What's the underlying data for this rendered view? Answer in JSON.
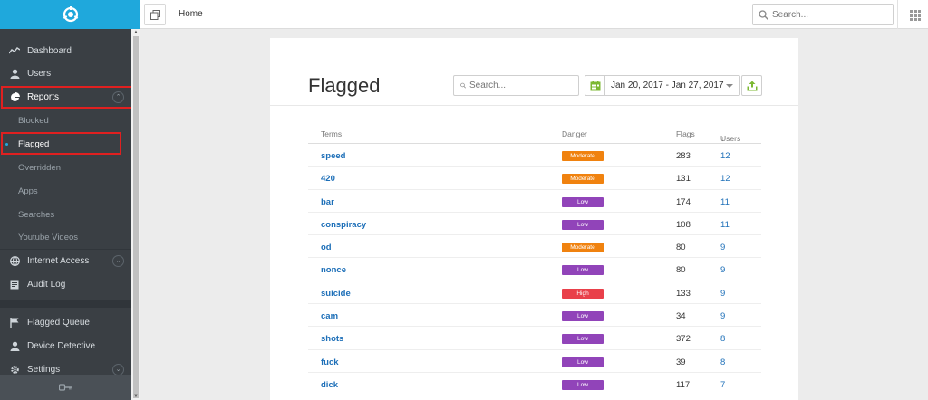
{
  "colors": {
    "brand": "#1fa8dc",
    "sidebar_bg": "#3a3f44",
    "link": "#1d6fb8",
    "highlight": "#e02020",
    "danger_moderate": "#f0820f",
    "danger_low": "#9144b9",
    "danger_high": "#e9404a",
    "calendar_green": "#7cb833"
  },
  "sidebar": {
    "logo_icon": "compass-logo-icon",
    "items": [
      {
        "label": "Dashboard",
        "icon": "chart-line-icon"
      },
      {
        "label": "Users",
        "icon": "user-icon"
      },
      {
        "label": "Reports",
        "icon": "pie-chart-icon"
      },
      {
        "label": "Blocked"
      },
      {
        "label": "Flagged"
      },
      {
        "label": "Overridden"
      },
      {
        "label": "Apps"
      },
      {
        "label": "Searches"
      },
      {
        "label": "Youtube Videos"
      },
      {
        "label": "Internet Access",
        "icon": "globe-icon"
      },
      {
        "label": "Audit Log",
        "icon": "document-icon"
      },
      {
        "label": "Flagged Queue",
        "icon": "flag-icon"
      },
      {
        "label": "Device Detective",
        "icon": "user-icon"
      },
      {
        "label": "Settings",
        "icon": "gear-icon"
      }
    ],
    "footer_icon": "key-icon"
  },
  "topbar": {
    "breadcrumb": "Home",
    "search_placeholder": "Search..."
  },
  "page": {
    "title": "Flagged",
    "search_placeholder": "Search...",
    "date_range": "Jan 20, 2017 - Jan 27, 2017"
  },
  "table": {
    "headers": {
      "terms": "Terms",
      "danger": "Danger",
      "flags": "Flags",
      "users": "Users"
    },
    "rows": [
      {
        "term": "speed",
        "danger": "Moderate",
        "flags": "283",
        "users": "12"
      },
      {
        "term": "420",
        "danger": "Moderate",
        "flags": "131",
        "users": "12"
      },
      {
        "term": "bar",
        "danger": "Low",
        "flags": "174",
        "users": "11"
      },
      {
        "term": "conspiracy",
        "danger": "Low",
        "flags": "108",
        "users": "11"
      },
      {
        "term": "od",
        "danger": "Moderate",
        "flags": "80",
        "users": "9"
      },
      {
        "term": "nonce",
        "danger": "Low",
        "flags": "80",
        "users": "9"
      },
      {
        "term": "suicide",
        "danger": "High",
        "flags": "133",
        "users": "9"
      },
      {
        "term": "cam",
        "danger": "Low",
        "flags": "34",
        "users": "9"
      },
      {
        "term": "shots",
        "danger": "Low",
        "flags": "372",
        "users": "8"
      },
      {
        "term": "fuck",
        "danger": "Low",
        "flags": "39",
        "users": "8"
      },
      {
        "term": "dick",
        "danger": "Low",
        "flags": "117",
        "users": "7"
      }
    ]
  }
}
